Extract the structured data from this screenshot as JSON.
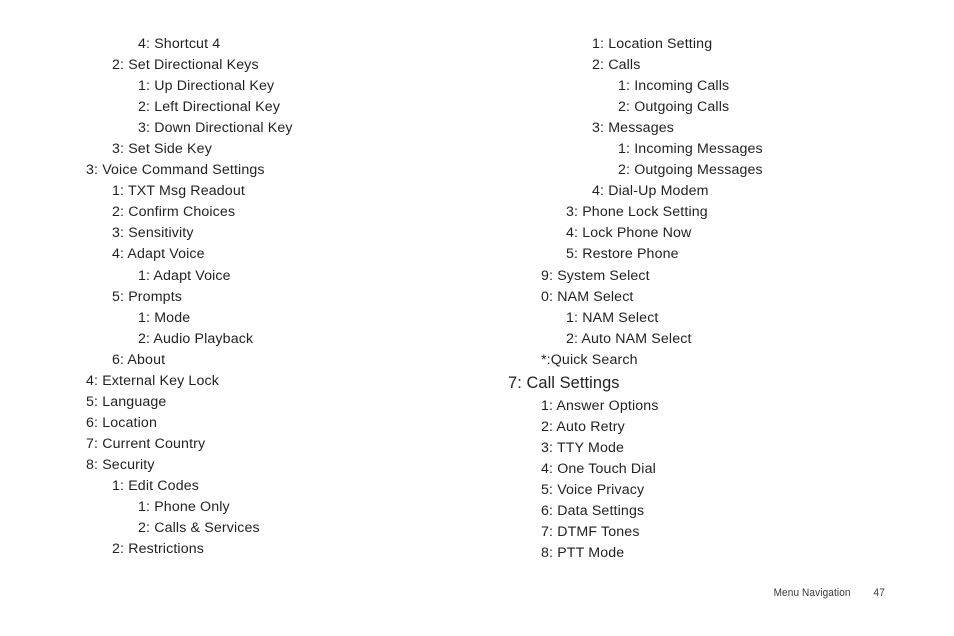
{
  "document": {
    "background_color": "#ffffff",
    "text_color": "#231f20"
  },
  "left_column": {
    "items": [
      {
        "text": "4: Shortcut 4",
        "level": "c"
      },
      {
        "text": "2: Set Directional Keys",
        "level": "b"
      },
      {
        "text": "1: Up Directional Key",
        "level": "c"
      },
      {
        "text": "2: Left Directional Key",
        "level": "c"
      },
      {
        "text": "3: Down Directional Key",
        "level": "c"
      },
      {
        "text": "3: Set Side Key",
        "level": "b"
      },
      {
        "text": "3: Voice Command Settings",
        "level": "a"
      },
      {
        "text": "1: TXT Msg Readout",
        "level": "b"
      },
      {
        "text": "2: Confirm Choices",
        "level": "b"
      },
      {
        "text": "3: Sensitivity",
        "level": "b"
      },
      {
        "text": "4: Adapt Voice",
        "level": "b"
      },
      {
        "text": "1: Adapt Voice",
        "level": "c"
      },
      {
        "text": "5: Prompts",
        "level": "b"
      },
      {
        "text": "1: Mode",
        "level": "c"
      },
      {
        "text": "2: Audio Playback",
        "level": "c"
      },
      {
        "text": "6: About",
        "level": "b"
      },
      {
        "text": "4: External Key Lock",
        "level": "a"
      },
      {
        "text": "5: Language",
        "level": "a"
      },
      {
        "text": "6: Location",
        "level": "a"
      },
      {
        "text": "7: Current Country",
        "level": "a"
      },
      {
        "text": "8: Security",
        "level": "a"
      },
      {
        "text": "1: Edit Codes",
        "level": "b"
      },
      {
        "text": "1: Phone Only",
        "level": "c"
      },
      {
        "text": "2: Calls & Services",
        "level": "c"
      },
      {
        "text": "2: Restrictions",
        "level": "b"
      }
    ]
  },
  "right_column": {
    "items": [
      {
        "text": "1: Location Setting",
        "level": "b",
        "heading": false
      },
      {
        "text": "2: Calls",
        "level": "b",
        "heading": false
      },
      {
        "text": "1: Incoming Calls",
        "level": "c",
        "heading": false
      },
      {
        "text": "2: Outgoing Calls",
        "level": "c",
        "heading": false
      },
      {
        "text": "3: Messages",
        "level": "b",
        "heading": false
      },
      {
        "text": "1: Incoming Messages",
        "level": "c",
        "heading": false
      },
      {
        "text": "2: Outgoing Messages",
        "level": "c",
        "heading": false
      },
      {
        "text": "4: Dial-Up Modem",
        "level": "b",
        "heading": false
      },
      {
        "text": "3: Phone Lock Setting",
        "level": "a",
        "heading": false
      },
      {
        "text": "4: Lock Phone Now",
        "level": "a",
        "heading": false
      },
      {
        "text": "5: Restore Phone",
        "level": "a",
        "heading": false
      },
      {
        "text": "9: System Select",
        "level": "s",
        "heading": false
      },
      {
        "text": "0: NAM Select",
        "level": "s",
        "heading": false
      },
      {
        "text": "1: NAM Select",
        "level": "a",
        "heading": false
      },
      {
        "text": "2: Auto NAM Select",
        "level": "a",
        "heading": false
      },
      {
        "text": "*:Quick Search",
        "level": "s",
        "heading": false
      },
      {
        "text": "7: Call Settings",
        "level": "0",
        "heading": true
      },
      {
        "text": "1: Answer Options",
        "level": "s",
        "heading": false
      },
      {
        "text": "2: Auto Retry",
        "level": "s",
        "heading": false
      },
      {
        "text": "3: TTY Mode",
        "level": "s",
        "heading": false
      },
      {
        "text": "4: One Touch Dial",
        "level": "s",
        "heading": false
      },
      {
        "text": "5: Voice Privacy",
        "level": "s",
        "heading": false
      },
      {
        "text": "6: Data Settings",
        "level": "s",
        "heading": false
      },
      {
        "text": "7: DTMF Tones",
        "level": "s",
        "heading": false
      },
      {
        "text": "8: PTT Mode",
        "level": "s",
        "heading": false
      }
    ]
  },
  "footer": {
    "label": "Menu Navigation",
    "page_number": "47"
  }
}
